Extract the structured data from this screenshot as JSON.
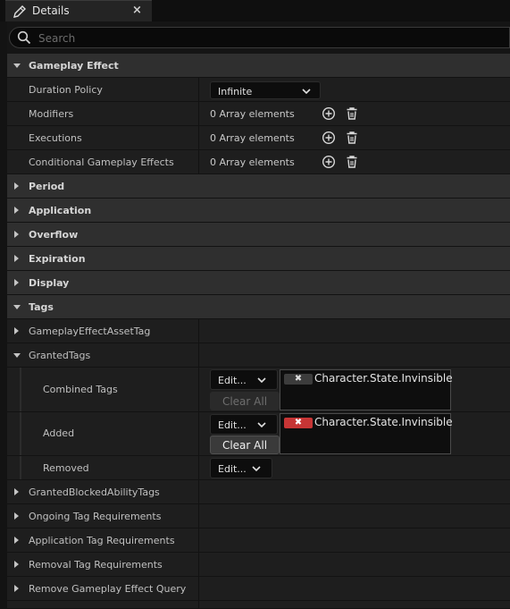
{
  "tab": {
    "title": "Details",
    "close_glyph": "×",
    "icon": "pencil-icon"
  },
  "search": {
    "placeholder": "Search",
    "value": ""
  },
  "sections": {
    "gameplay_effect": {
      "label": "Gameplay Effect"
    },
    "period": {
      "label": "Period"
    },
    "application": {
      "label": "Application"
    },
    "overflow": {
      "label": "Overflow"
    },
    "expiration": {
      "label": "Expiration"
    },
    "display": {
      "label": "Display"
    },
    "tags": {
      "label": "Tags"
    }
  },
  "properties": {
    "duration_policy": {
      "label": "Duration Policy",
      "value": "Infinite"
    },
    "modifiers": {
      "label": "Modifiers",
      "value": "0 Array elements"
    },
    "executions": {
      "label": "Executions",
      "value": "0 Array elements"
    },
    "conditional_effects": {
      "label": "Conditional Gameplay Effects",
      "value": "0 Array elements"
    }
  },
  "tags": {
    "asset_tag": {
      "label": "GameplayEffectAssetTag"
    },
    "granted_tags": {
      "label": "GrantedTags",
      "combined": {
        "label": "Combined Tags",
        "edit_label": "Edit...",
        "clear_label": "Clear All",
        "tag": "Character.State.Invinsible"
      },
      "added": {
        "label": "Added",
        "edit_label": "Edit...",
        "clear_label": "Clear All",
        "tag": "Character.State.Invinsible"
      },
      "removed": {
        "label": "Removed",
        "edit_label": "Edit..."
      }
    },
    "more": [
      {
        "label": "GrantedBlockedAbilityTags"
      },
      {
        "label": "Ongoing Tag Requirements"
      },
      {
        "label": "Application Tag Requirements"
      },
      {
        "label": "Removal Tag Requirements"
      },
      {
        "label": "Remove Gameplay Effect Query"
      }
    ]
  },
  "chip_glyph": "✖",
  "colors": {
    "remove_chip": "#c63535",
    "panel_bg": "#1e1e1e",
    "category_bg": "#2f2f2f"
  }
}
